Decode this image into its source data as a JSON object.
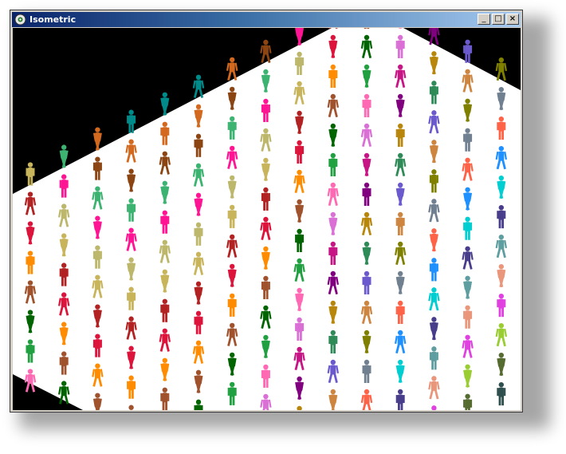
{
  "window": {
    "title": "Isometric",
    "minimize_glyph": "_",
    "maximize_glyph": "□",
    "close_glyph": "×"
  },
  "scene": {
    "description_icons": [
      "app-icon",
      "minimize-icon",
      "maximize-icon",
      "close-icon"
    ],
    "floor_color": "#ffffff",
    "background_color": "#000000",
    "figure_colors": [
      "#c8b45a",
      "#e040e0",
      "#20a040",
      "#8a2be2",
      "#2e8b57",
      "#d2691e",
      "#1e90ff",
      "#b22222",
      "#9acd32",
      "#ff69b4",
      "#20b2aa",
      "#6a5acd",
      "#8b4513",
      "#00ced1",
      "#dc143c",
      "#556b2f",
      "#da70d6",
      "#4682b4",
      "#cd853f",
      "#3cb371",
      "#483d8b",
      "#ff8c00",
      "#2f4f4f",
      "#c71585",
      "#7b68ee",
      "#808000",
      "#ff1493",
      "#5f9ea0",
      "#a0522d",
      "#32cd32",
      "#800080",
      "#daa520",
      "#708090",
      "#bdb76b",
      "#e9967a",
      "#006400",
      "#9932cc",
      "#b8860b",
      "#008b8b",
      "#ff6347"
    ]
  }
}
